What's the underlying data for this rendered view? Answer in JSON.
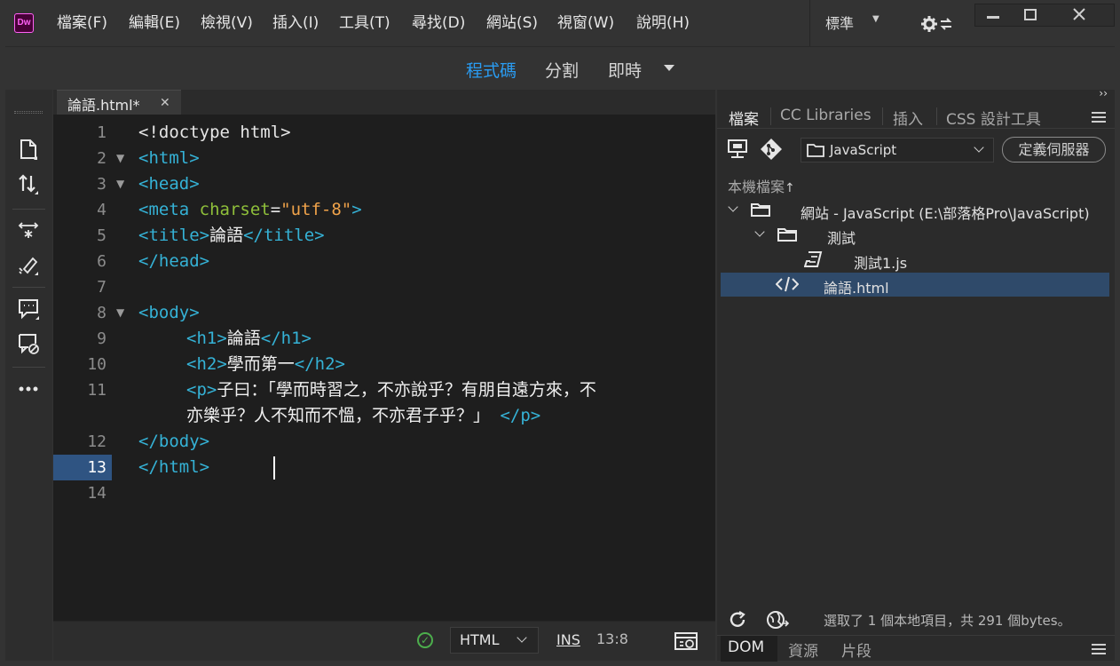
{
  "app": {
    "logo_text": "Dw",
    "menu": [
      "檔案(F)",
      "編輯(E)",
      "檢視(V)",
      "插入(I)",
      "工具(T)",
      "尋找(D)",
      "網站(S)",
      "視窗(W)",
      "說明(H)"
    ],
    "workspace": "標準"
  },
  "viewbar": {
    "code": "程式碼",
    "split": "分割",
    "live": "即時"
  },
  "document": {
    "tab_label": "論語.html*",
    "line_numbers": [
      "1",
      "2",
      "3",
      "4",
      "5",
      "6",
      "7",
      "8",
      "9",
      "10",
      "11",
      "",
      "12",
      "13",
      "14"
    ],
    "current_line": "13",
    "lines": {
      "l1": "<!doctype html>",
      "l2_tag": "<html>",
      "l3_tag": "<head>",
      "l4_open": "<meta ",
      "l4_attr": "charset",
      "l4_eq": "=",
      "l4_val": "\"utf-8\"",
      "l4_close": ">",
      "l5_open": "<title>",
      "l5_text": "論語",
      "l5_close": "</title>",
      "l6_tag": "</head>",
      "l8_tag": "<body>",
      "l9_open": "<h1>",
      "l9_text": "論語",
      "l9_close": "</h1>",
      "l10_open": "<h2>",
      "l10_text": "學而第一",
      "l10_close": "</h2>",
      "l11_open": "<p>",
      "l11_text_a": "子曰：「學而時習之，不亦說乎？有朋自遠方來，不",
      "l11_text_b": "亦樂乎？人不知而不慍，不亦君子乎？」",
      "l11_close": "</p>",
      "l12_tag": "</body>",
      "l13_tag": "</html>"
    }
  },
  "statusbar": {
    "language": "HTML",
    "mode": "INS",
    "position": "13:8"
  },
  "right_panel": {
    "tabs": [
      "檔案",
      "CC Libraries",
      "插入",
      "CSS 設計工具"
    ],
    "site_select": "JavaScript",
    "define_server": "定義伺服器",
    "local_files_label": "本機檔案",
    "sort_arrow": "↑",
    "tree": [
      {
        "label": "網站 - JavaScript (E:\\部落格Pro\\JavaScript)"
      },
      {
        "label": "測試"
      },
      {
        "label": "測試1.js"
      },
      {
        "label": "論語.html"
      }
    ],
    "status_text": "選取了 1 個本地項目，共 291 個bytes。",
    "bottom_tabs": [
      "DOM",
      "資源",
      "片段"
    ]
  },
  "colors": {
    "accent": "#2a9cf2",
    "tag": "#35b2d6",
    "attribute": "#8fbf3a",
    "value": "#f0a34a",
    "selection": "#2f4a6a",
    "current_line": "#2f5482"
  },
  "icons": {
    "toolbar": [
      "file-icon",
      "sort-arrows-icon",
      "expand-icon",
      "brush-icon",
      "comment-icon",
      "uncomment-icon",
      "more-icon"
    ],
    "files_toolbar": [
      "connect-icon",
      "git-icon",
      "folder-icon"
    ],
    "files_status": [
      "refresh-icon",
      "globe-icon"
    ]
  }
}
